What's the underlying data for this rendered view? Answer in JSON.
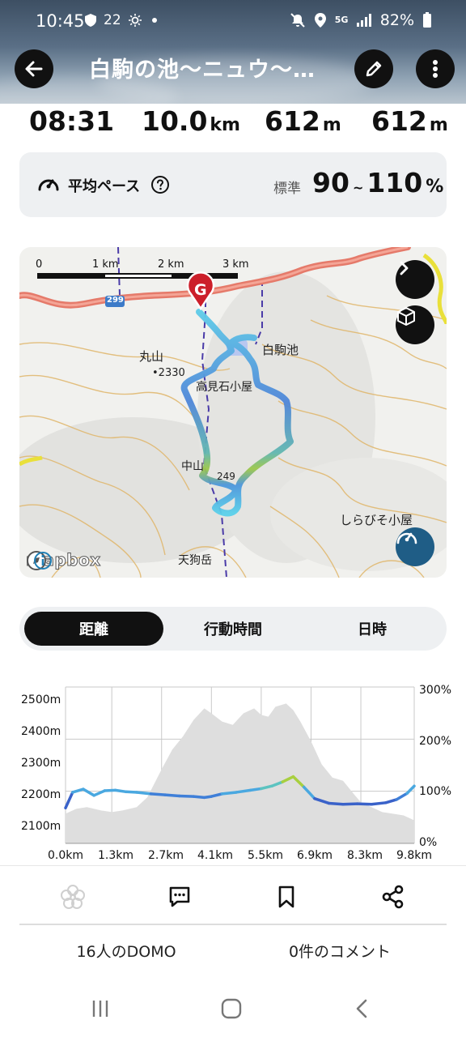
{
  "status_bar": {
    "time": "10:45",
    "temp": "22",
    "network": "5G",
    "battery": "82%"
  },
  "header": {
    "title": "白駒の池〜ニュウ〜…",
    "back_icon": "arrow-left-icon",
    "edit_icon": "pencil-icon",
    "more_icon": "more-vertical-icon"
  },
  "stats": {
    "duration": "08:31",
    "distance_value": "10.0",
    "distance_unit": "km",
    "ascent_value": "612",
    "ascent_unit": "m",
    "descent_value": "612",
    "descent_unit": "m"
  },
  "pace": {
    "label": "平均ペース",
    "standard_label": "標準",
    "min": "90",
    "tilde": "~",
    "max": "110",
    "unit": "%"
  },
  "map": {
    "scale_labels": [
      "0",
      "1 km",
      "2 km",
      "3 km"
    ],
    "road_number": "299",
    "goal_marker": "G",
    "place_labels": {
      "shirakoma_ike": "白駒池",
      "maruyama": "丸山",
      "peak_2330": "•2330",
      "takami_ishi": "高見石小屋",
      "nakayama": "中山",
      "shirabiso": "しらびそ小屋",
      "tengudake": "天狗岳",
      "peak_249": "249"
    },
    "attribution": "mapbox"
  },
  "tabs": {
    "items": [
      "距離",
      "行動時間",
      "日時"
    ],
    "active_index": 0
  },
  "chart_data": {
    "type": "line",
    "x_unit": "km",
    "x_ticks": [
      "0.0km",
      "1.3km",
      "2.7km",
      "4.1km",
      "5.5km",
      "6.9km",
      "8.3km",
      "9.8km"
    ],
    "y_left_ticks": [
      "2500m",
      "2400m",
      "2300m",
      "2200m",
      "2100m"
    ],
    "y_left_range": [
      2050,
      2525
    ],
    "y_right_ticks": [
      "300%",
      "200%",
      "100%",
      "0%"
    ],
    "y_right_range": [
      0,
      300
    ],
    "series": [
      {
        "kind": "elevation",
        "x": [
          0.0,
          0.3,
          0.6,
          1.0,
          1.3,
          1.6,
          2.0,
          2.3,
          2.7,
          3.0,
          3.3,
          3.6,
          3.9,
          4.1,
          4.4,
          4.7,
          5.0,
          5.3,
          5.5,
          5.7,
          5.9,
          6.2,
          6.4,
          6.6,
          6.9,
          7.2,
          7.5,
          7.8,
          8.1,
          8.3,
          8.6,
          8.9,
          9.2,
          9.5,
          9.8
        ],
        "y": [
          2140,
          2155,
          2160,
          2150,
          2145,
          2150,
          2160,
          2190,
          2275,
          2335,
          2375,
          2425,
          2460,
          2445,
          2420,
          2410,
          2445,
          2460,
          2440,
          2435,
          2465,
          2475,
          2455,
          2420,
          2360,
          2290,
          2250,
          2240,
          2200,
          2175,
          2160,
          2145,
          2140,
          2135,
          2120
        ]
      },
      {
        "kind": "pace_percent",
        "x": [
          0.0,
          0.2,
          0.5,
          0.8,
          1.1,
          1.4,
          1.7,
          2.0,
          2.4,
          2.8,
          3.2,
          3.6,
          3.9,
          4.1,
          4.4,
          4.8,
          5.2,
          5.5,
          5.8,
          6.1,
          6.4,
          6.7,
          7.0,
          7.4,
          7.8,
          8.2,
          8.6,
          9.0,
          9.3,
          9.6,
          9.8
        ],
        "y": [
          68,
          98,
          104,
          92,
          101,
          102,
          99,
          98,
          95,
          93,
          91,
          90,
          88,
          90,
          95,
          98,
          102,
          105,
          110,
          118,
          128,
          108,
          86,
          77,
          75,
          76,
          75,
          78,
          84,
          96,
          110
        ]
      }
    ]
  },
  "actions": {
    "domo_icon": "domo-flower-icon",
    "comment_icon": "comment-icon",
    "bookmark_icon": "bookmark-icon",
    "share_icon": "share-icon",
    "domo_count": "16人のDOMO",
    "comment_count": "0件のコメント"
  },
  "nav": {
    "recents_icon": "recents-icon",
    "home_icon": "home-icon",
    "back_icon": "back-chevron-icon"
  }
}
